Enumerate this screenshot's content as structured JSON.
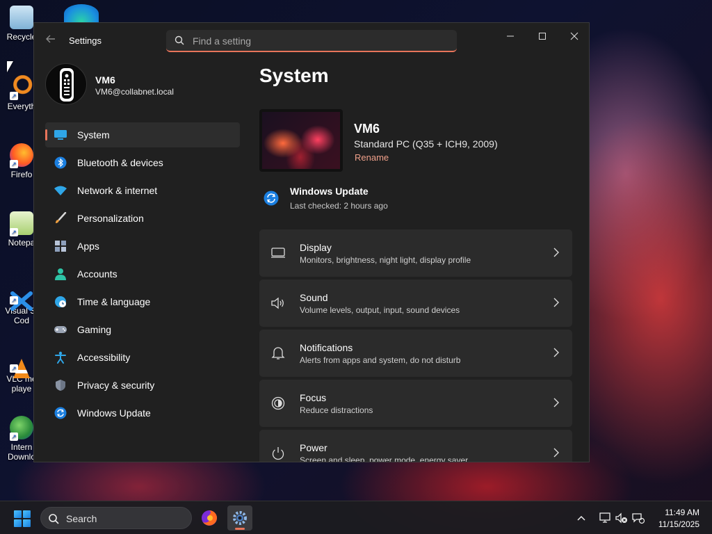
{
  "desktop": {
    "icons": [
      {
        "label": "Recycle",
        "icon": "recycle-bin-icon"
      },
      {
        "label": "Everyth",
        "icon": "everything-search-icon"
      },
      {
        "label": "Firefo",
        "icon": "firefox-icon"
      },
      {
        "label": "Notepa",
        "icon": "notepad-icon"
      },
      {
        "label": "Visual St\nCod",
        "icon": "vscode-icon"
      },
      {
        "label": "VLC me\nplaye",
        "icon": "vlc-icon"
      },
      {
        "label": "Intern\nDownlo",
        "icon": "internet-download-manager-icon"
      }
    ]
  },
  "window": {
    "title": "Settings",
    "search_placeholder": "Find a setting"
  },
  "profile": {
    "name": "VM6",
    "email": "VM6@collabnet.local"
  },
  "nav": {
    "items": [
      {
        "label": "System",
        "icon": "system-display-icon",
        "active": true
      },
      {
        "label": "Bluetooth & devices",
        "icon": "bluetooth-icon"
      },
      {
        "label": "Network & internet",
        "icon": "wifi-icon"
      },
      {
        "label": "Personalization",
        "icon": "paintbrush-icon"
      },
      {
        "label": "Apps",
        "icon": "apps-icon"
      },
      {
        "label": "Accounts",
        "icon": "person-icon"
      },
      {
        "label": "Time & language",
        "icon": "clock-globe-icon"
      },
      {
        "label": "Gaming",
        "icon": "gamepad-icon"
      },
      {
        "label": "Accessibility",
        "icon": "accessibility-icon"
      },
      {
        "label": "Privacy & security",
        "icon": "shield-icon"
      },
      {
        "label": "Windows Update",
        "icon": "sync-icon"
      }
    ]
  },
  "main": {
    "title": "System",
    "device": {
      "name": "VM6",
      "model": "Standard PC (Q35 + ICH9, 2009)",
      "rename_label": "Rename"
    },
    "update": {
      "title": "Windows Update",
      "subtitle": "Last checked: 2 hours ago"
    },
    "cards": [
      {
        "title": "Display",
        "subtitle": "Monitors, brightness, night light, display profile",
        "icon": "monitor-icon"
      },
      {
        "title": "Sound",
        "subtitle": "Volume levels, output, input, sound devices",
        "icon": "speaker-icon"
      },
      {
        "title": "Notifications",
        "subtitle": "Alerts from apps and system, do not disturb",
        "icon": "bell-icon"
      },
      {
        "title": "Focus",
        "subtitle": "Reduce distractions",
        "icon": "focus-icon"
      },
      {
        "title": "Power",
        "subtitle": "Screen and sleep, power mode, energy saver",
        "icon": "power-icon"
      }
    ]
  },
  "taskbar": {
    "search_label": "Search",
    "time": "11:49 AM",
    "date": "11/15/2025"
  },
  "colors": {
    "accent": "#e8745a",
    "window_bg": "#202020",
    "card_bg": "#2b2b2b"
  }
}
